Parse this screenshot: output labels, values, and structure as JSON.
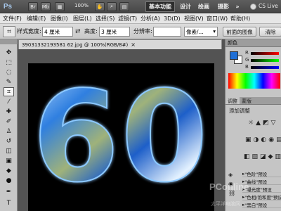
{
  "app": {
    "logo": "Ps"
  },
  "titlebar": {
    "buttons": [
      {
        "label": "Br"
      },
      {
        "label": "Mb"
      }
    ],
    "zoom": "100%",
    "workspaces": [
      "基本功能",
      "设计",
      "绘画",
      "摄影"
    ],
    "overflow": "»",
    "cslive": "CS Live"
  },
  "menu": {
    "items": [
      "文件(F)",
      "编辑(E)",
      "图像(I)",
      "图层(L)",
      "选择(S)",
      "滤镜(T)",
      "分析(A)",
      "3D(D)",
      "视图(V)",
      "窗口(W)",
      "帮助(H)"
    ]
  },
  "options": {
    "style_label": "样式:",
    "style_value": "正常",
    "width_label": "宽度:",
    "width_value": "4 厘米",
    "height_label": "高度:",
    "height_value": "3 厘米",
    "resolution_label": "分辨率:",
    "resolution_value": "",
    "unit_value": "像素/...",
    "front_image_button": "前面的图像",
    "clear_button": "清除"
  },
  "document": {
    "tab_title": "39031332193581 62.jpg @ 100%(RGB/8#)"
  },
  "canvas": {
    "art_text": "60"
  },
  "panels": {
    "color_tab": "颜色",
    "channel_labels": [
      "R",
      "G",
      "B"
    ],
    "adjust_tab": "调整",
    "mask_tab": "蒙版",
    "adjust_title": "添加调整",
    "presets": [
      "\"色阶\"预设",
      "\"曲线\"预设",
      "\"曝光度\"预设",
      "\"色相/饱和度\"预设",
      "\"黑白\"预设"
    ]
  },
  "colors": {
    "fg": "#1f6fd6",
    "bg": "#ffffff",
    "accent": "#2a6fe0"
  },
  "watermark": {
    "brand": "PConline",
    "sub": "太平洋电脑网"
  }
}
